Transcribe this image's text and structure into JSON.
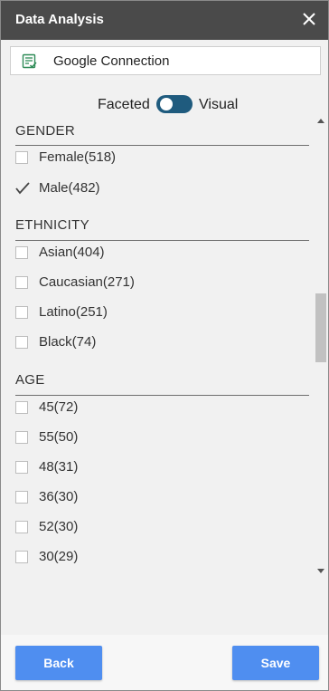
{
  "header": {
    "title": "Data Analysis"
  },
  "connection": {
    "label": "Google Connection"
  },
  "mode_toggle": {
    "left_label": "Faceted",
    "right_label": "Visual"
  },
  "sections": [
    {
      "title": "GENDER",
      "items": [
        {
          "label": "Female(518)",
          "checked": false
        },
        {
          "label": "Male(482)",
          "checked": true
        }
      ]
    },
    {
      "title": "ETHNICITY",
      "items": [
        {
          "label": "Asian(404)",
          "checked": false
        },
        {
          "label": "Caucasian(271)",
          "checked": false
        },
        {
          "label": "Latino(251)",
          "checked": false
        },
        {
          "label": "Black(74)",
          "checked": false
        }
      ]
    },
    {
      "title": "AGE",
      "items": [
        {
          "label": "45(72)",
          "checked": false
        },
        {
          "label": "55(50)",
          "checked": false
        },
        {
          "label": "48(31)",
          "checked": false
        },
        {
          "label": "36(30)",
          "checked": false
        },
        {
          "label": "52(30)",
          "checked": false
        },
        {
          "label": "30(29)",
          "checked": false
        }
      ]
    }
  ],
  "footer": {
    "back_label": "Back",
    "save_label": "Save"
  },
  "colors": {
    "titlebar": "#4a4a4a",
    "accent": "#4f8ef0",
    "toggle": "#1f5b7e"
  }
}
